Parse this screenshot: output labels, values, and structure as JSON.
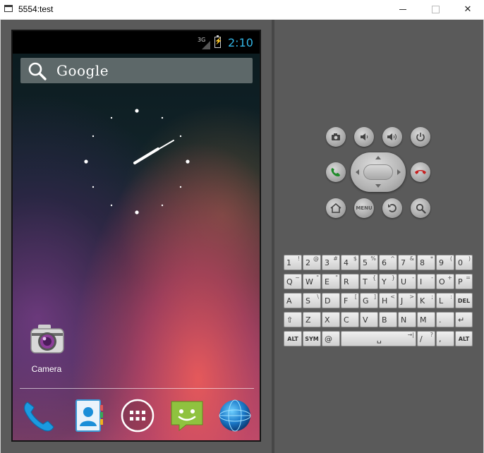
{
  "window": {
    "title": "5554:test",
    "controls": {
      "minimize": "—",
      "maximize": "☐",
      "close": "✕"
    }
  },
  "statusbar": {
    "network": "3G",
    "time": "2:10",
    "accent_color": "#33b5e5"
  },
  "search": {
    "label": "Google",
    "icon": "search-icon"
  },
  "home": {
    "apps": [
      {
        "label": "Camera",
        "icon": "camera-icon"
      }
    ],
    "dock": [
      {
        "icon": "phone-icon"
      },
      {
        "icon": "contacts-icon"
      },
      {
        "icon": "app-drawer-icon"
      },
      {
        "icon": "messaging-icon"
      },
      {
        "icon": "browser-icon"
      }
    ]
  },
  "controls": {
    "row1": [
      "camera-icon",
      "volume-down-icon",
      "volume-up-icon",
      "power-icon"
    ],
    "row2": [
      "call-icon",
      "dpad",
      "end-call-icon"
    ],
    "row3": {
      "home": "home-icon",
      "menu": "MENU",
      "back": "back-icon",
      "search": "search-icon"
    }
  },
  "keyboard": {
    "rows": [
      [
        {
          "main": "1",
          "alt": "!"
        },
        {
          "main": "2",
          "alt": "@"
        },
        {
          "main": "3",
          "alt": "#"
        },
        {
          "main": "4",
          "alt": "$"
        },
        {
          "main": "5",
          "alt": "%"
        },
        {
          "main": "6",
          "alt": "^"
        },
        {
          "main": "7",
          "alt": "&"
        },
        {
          "main": "8",
          "alt": "*"
        },
        {
          "main": "9",
          "alt": "("
        },
        {
          "main": "0",
          "alt": ")"
        }
      ],
      [
        {
          "main": "Q",
          "alt": "~"
        },
        {
          "main": "W",
          "alt": "\""
        },
        {
          "main": "E",
          "alt": "\""
        },
        {
          "main": "R",
          "alt": ""
        },
        {
          "main": "T",
          "alt": "{"
        },
        {
          "main": "Y",
          "alt": "}"
        },
        {
          "main": "U",
          "alt": "-"
        },
        {
          "main": "I",
          "alt": "-"
        },
        {
          "main": "O",
          "alt": "+"
        },
        {
          "main": "P",
          "alt": "="
        }
      ],
      [
        {
          "main": "A",
          "alt": ""
        },
        {
          "main": "S",
          "alt": "\\"
        },
        {
          "main": "D",
          "alt": ""
        },
        {
          "main": "F",
          "alt": "["
        },
        {
          "main": "G",
          "alt": "]"
        },
        {
          "main": "H",
          "alt": "<"
        },
        {
          "main": "J",
          "alt": ">"
        },
        {
          "main": "K",
          "alt": ";"
        },
        {
          "main": "L",
          "alt": ":"
        },
        {
          "main": "DEL",
          "alt": ""
        }
      ],
      [
        {
          "main": "⇧",
          "alt": ""
        },
        {
          "main": "Z",
          "alt": ""
        },
        {
          "main": "X",
          "alt": ""
        },
        {
          "main": "C",
          "alt": ""
        },
        {
          "main": "V",
          "alt": ""
        },
        {
          "main": "B",
          "alt": ""
        },
        {
          "main": "N",
          "alt": ""
        },
        {
          "main": "M",
          "alt": ""
        },
        {
          "main": ".",
          "alt": ""
        },
        {
          "main": "↵",
          "alt": ""
        }
      ],
      [
        {
          "main": "ALT",
          "alt": ""
        },
        {
          "main": "SYM",
          "alt": ""
        },
        {
          "main": "@",
          "alt": ""
        },
        {
          "main": "␣",
          "alt": "→|"
        },
        {
          "main": "/",
          "alt": "?"
        },
        {
          "main": ",",
          "alt": ""
        },
        {
          "main": "ALT",
          "alt": ""
        }
      ]
    ]
  }
}
